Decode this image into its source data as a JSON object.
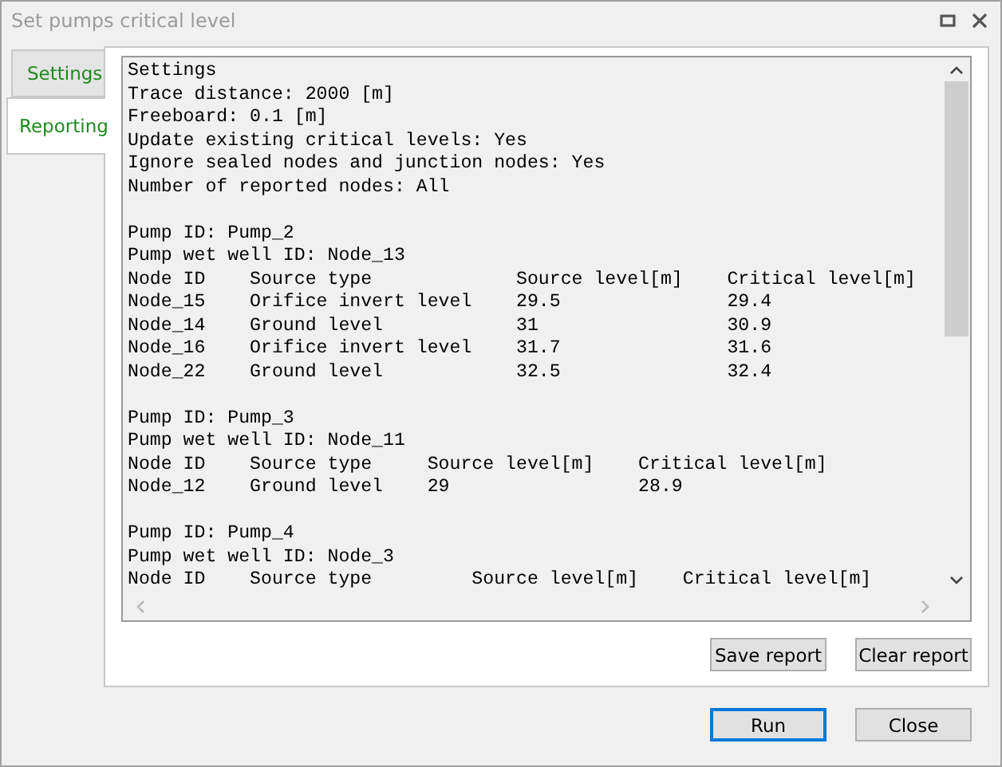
{
  "window": {
    "title": "Set pumps critical level"
  },
  "tabs": [
    {
      "label": "Settings",
      "selected": false
    },
    {
      "label": "Reporting",
      "selected": true
    }
  ],
  "report": {
    "sections": [
      [
        "Settings",
        "Trace distance: 2000 [m]",
        "Freeboard: 0.1 [m]",
        "Update existing critical levels: Yes",
        "Ignore sealed nodes and junction nodes: Yes",
        "Number of reported nodes: All"
      ],
      [
        "Pump ID: Pump_2",
        "Pump wet well ID: Node_13",
        "Node ID    Source type             Source level[m]    Critical level[m]",
        "Node_15    Orifice invert level    29.5               29.4",
        "Node_14    Ground level            31                 30.9",
        "Node_16    Orifice invert level    31.7               31.6",
        "Node_22    Ground level            32.5               32.4"
      ],
      [
        "Pump ID: Pump_3",
        "Pump wet well ID: Node_11",
        "Node ID    Source type     Source level[m]    Critical level[m]",
        "Node_12    Ground level    29                 28.9"
      ],
      [
        "Pump ID: Pump_4",
        "Pump wet well ID: Node_3",
        "Node ID    Source type         Source level[m]    Critical level[m]"
      ]
    ]
  },
  "report_buttons": [
    "Save report",
    "Clear report"
  ],
  "footer_buttons": [
    {
      "label": "Run",
      "selected": true
    },
    {
      "label": "Close",
      "selected": false
    }
  ]
}
